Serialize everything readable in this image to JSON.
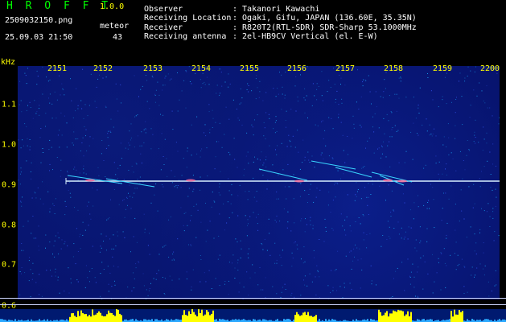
{
  "header": {
    "app_title": "H R O F F T",
    "app_version": "1.0.0",
    "filename": "2509032150.png",
    "timestamp": "25.09.03 21:50",
    "meteor_label": "meteor",
    "meteor_count": "43"
  },
  "info": {
    "rows": [
      {
        "label": "Observer",
        "value": ": Takanori Kawachi"
      },
      {
        "label": "Receiving Location",
        "value": ": Ogaki, Gifu, JAPAN (136.60E, 35.35N)"
      },
      {
        "label": "Receiver",
        "value": ": R820T2(RTL-SDR) SDR-Sharp 53.1000MHz"
      },
      {
        "label": "Receiving antenna",
        "value": ": 2el-HB9CV Vertical (el. E-W)"
      }
    ]
  },
  "axes": {
    "khz_label": "kHz",
    "x_ticks": [
      "2151",
      "2152",
      "2153",
      "2154",
      "2155",
      "2156",
      "2157",
      "2158",
      "2159",
      "2200"
    ],
    "y_ticks": [
      "1.1",
      "1.0",
      "0.9",
      "0.8",
      "0.7",
      "0.6"
    ]
  },
  "colors": {
    "background": "#06126a",
    "carrier": "#d8f0ff",
    "trace": "#3ad6ff",
    "bars": "#ffff00",
    "noise": "#1ab0ff"
  }
}
